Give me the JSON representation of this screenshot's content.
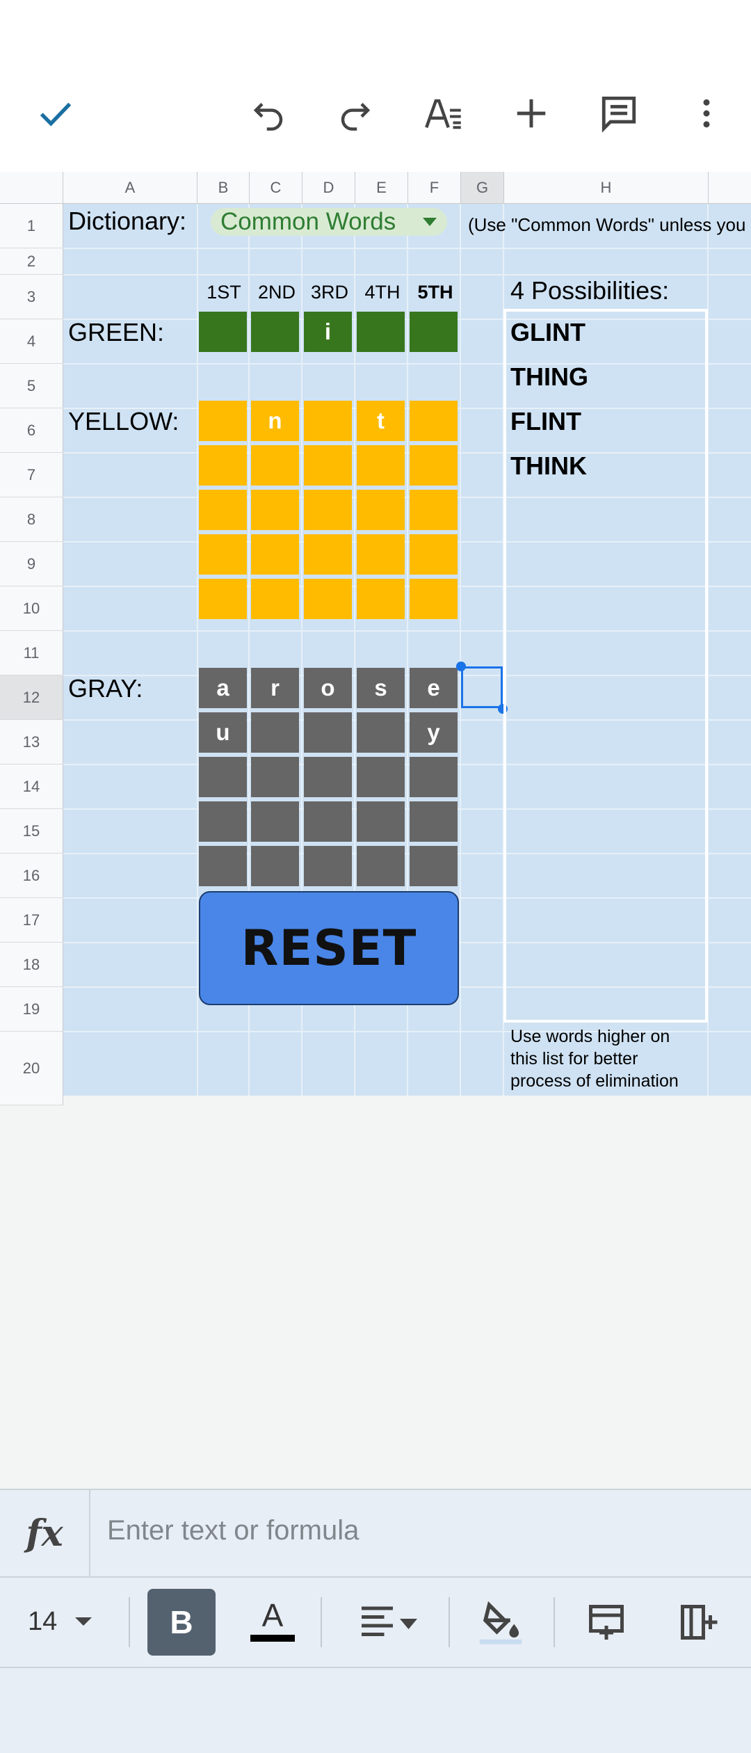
{
  "toolbar": {
    "confirm_icon": "check-icon",
    "undo_icon": "undo-icon",
    "redo_icon": "redo-icon",
    "format_icon": "text-format-icon",
    "insert_icon": "plus-icon",
    "comment_icon": "comment-icon",
    "more_icon": "more-vert-icon"
  },
  "columns": [
    "A",
    "B",
    "C",
    "D",
    "E",
    "F",
    "G",
    "H"
  ],
  "rows": [
    "1",
    "2",
    "3",
    "4",
    "5",
    "6",
    "7",
    "8",
    "9",
    "10",
    "11",
    "12",
    "13",
    "14",
    "15",
    "16",
    "17",
    "18",
    "19",
    "20"
  ],
  "sheet": {
    "dictionary_label": "Dictionary:",
    "dictionary_value": "Common Words",
    "dictionary_note": "(Use \"Common Words\" unless you",
    "position_headers": [
      "1ST",
      "2ND",
      "3RD",
      "4TH",
      "5TH"
    ],
    "green_label": "GREEN:",
    "yellow_label": "YELLOW:",
    "gray_label": "GRAY:",
    "green_row": [
      "",
      "",
      "i",
      "",
      ""
    ],
    "yellow_rows": [
      [
        "",
        "n",
        "",
        "t",
        ""
      ],
      [
        "",
        "",
        "",
        "",
        ""
      ],
      [
        "",
        "",
        "",
        "",
        ""
      ],
      [
        "",
        "",
        "",
        "",
        ""
      ],
      [
        "",
        "",
        "",
        "",
        ""
      ]
    ],
    "gray_rows": [
      [
        "a",
        "r",
        "o",
        "s",
        "e"
      ],
      [
        "u",
        "",
        "",
        "",
        "y"
      ],
      [
        "",
        "",
        "",
        "",
        ""
      ],
      [
        "",
        "",
        "",
        "",
        ""
      ],
      [
        "",
        "",
        "",
        "",
        ""
      ]
    ],
    "reset_label": "RESET",
    "possibilities_title": "4 Possibilities:",
    "possibilities": [
      "GLINT",
      "THING",
      "FLINT",
      "THINK"
    ],
    "note_lines": [
      "Use words higher on",
      "this list for better",
      "process of elimination"
    ]
  },
  "formula": {
    "fx_label": "fx",
    "placeholder": "Enter text or formula"
  },
  "format_bar": {
    "font_size": "14",
    "bold_label": "B",
    "text_color_label": "A",
    "align_icon": "align-left-icon",
    "fill_icon": "fill-color-icon",
    "insert_row_icon": "insert-row-icon",
    "insert_col_icon": "insert-column-icon"
  },
  "colors": {
    "green": "#38761d",
    "yellow": "#ffbb00",
    "gray": "#666666",
    "sheet_bg": "#cfe2f3",
    "reset_button": "#4a86e8",
    "selection": "#1a73e8"
  }
}
